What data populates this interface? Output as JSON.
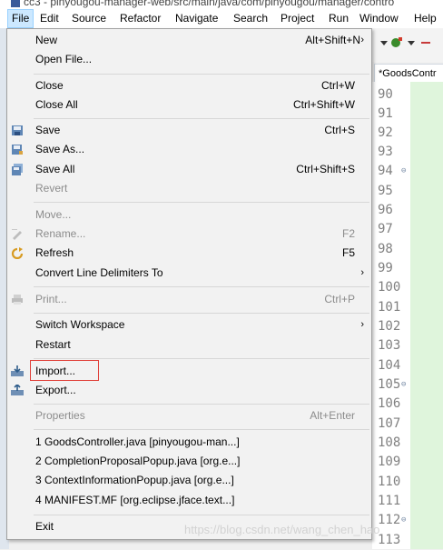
{
  "titlebar": {
    "text": "cc3 - pinyougou-manager-web/src/main/java/com/pinyougou/manager/contro"
  },
  "menubar": {
    "items": [
      "File",
      "Edit",
      "Source",
      "Refactor",
      "Navigate",
      "Search",
      "Project",
      "Run",
      "Window",
      "Help"
    ]
  },
  "editor": {
    "tab_label": "*GoodsContr",
    "line_numbers": [
      "90",
      "91",
      "92",
      "93",
      "94",
      "95",
      "96",
      "97",
      "98",
      "99",
      "100",
      "101",
      "102",
      "103",
      "104",
      "105",
      "106",
      "107",
      "108",
      "109",
      "110",
      "111",
      "112",
      "113"
    ]
  },
  "file_menu": {
    "new": {
      "label": "New",
      "shortcut": "Alt+Shift+N"
    },
    "open_file": {
      "label": "Open File..."
    },
    "close": {
      "label": "Close",
      "shortcut": "Ctrl+W"
    },
    "close_all": {
      "label": "Close All",
      "shortcut": "Ctrl+Shift+W"
    },
    "save": {
      "label": "Save",
      "shortcut": "Ctrl+S"
    },
    "save_as": {
      "label": "Save As..."
    },
    "save_all": {
      "label": "Save All",
      "shortcut": "Ctrl+Shift+S"
    },
    "revert": {
      "label": "Revert"
    },
    "move": {
      "label": "Move..."
    },
    "rename": {
      "label": "Rename...",
      "shortcut": "F2"
    },
    "refresh": {
      "label": "Refresh",
      "shortcut": "F5"
    },
    "convert": {
      "label": "Convert Line Delimiters To"
    },
    "print": {
      "label": "Print...",
      "shortcut": "Ctrl+P"
    },
    "switch_workspace": {
      "label": "Switch Workspace"
    },
    "restart": {
      "label": "Restart"
    },
    "import": {
      "label": "Import..."
    },
    "export": {
      "label": "Export..."
    },
    "properties": {
      "label": "Properties",
      "shortcut": "Alt+Enter"
    },
    "recent": [
      "1 GoodsController.java  [pinyougou-man...]",
      "2 CompletionProposalPopup.java  [org.e...]",
      "3 ContextInformationPopup.java  [org.e...]",
      "4 MANIFEST.MF  [org.eclipse.jface.text...]"
    ],
    "exit": {
      "label": "Exit"
    }
  },
  "watermark": "https://blog.csdn.net/wang_chen_hao",
  "colors": {
    "menu_highlight": "#cce8ff",
    "import_box": "#e0413a",
    "editor_bg": "#dff5dc"
  }
}
